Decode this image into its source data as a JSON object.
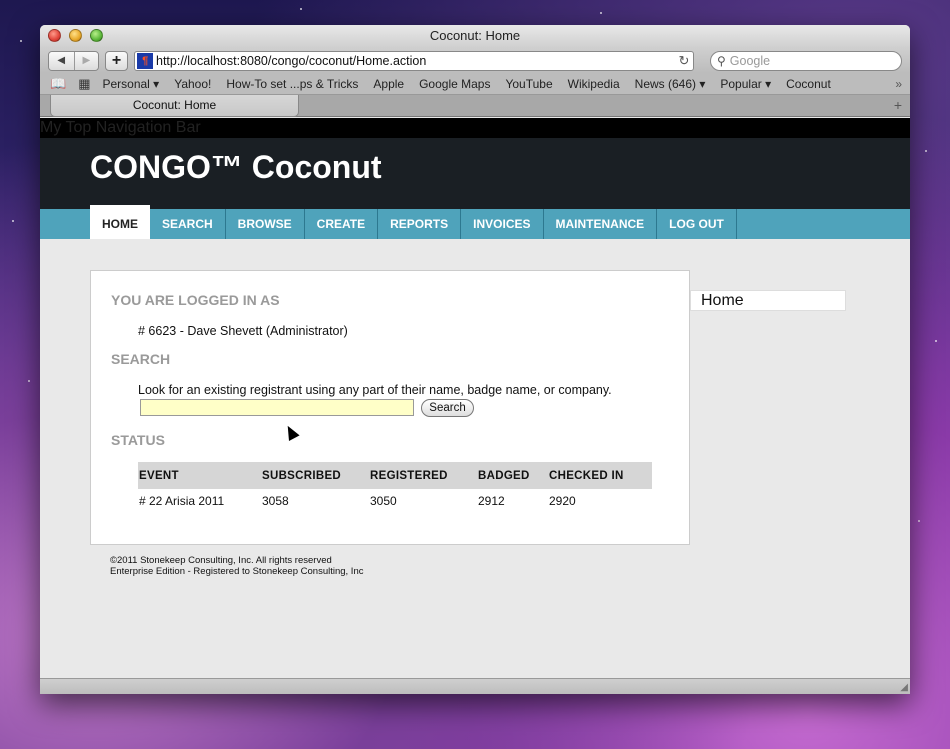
{
  "window": {
    "title": "Coconut: Home"
  },
  "toolbar": {
    "back": "◀",
    "forward": "▶",
    "add": "+",
    "url": "http://localhost:8080/congo/coconut/Home.action",
    "reload": "↻",
    "search_placeholder": "Google"
  },
  "bookmarks": {
    "items": [
      "Personal ▾",
      "Yahoo!",
      "How-To set ...ps & Tricks",
      "Apple",
      "Google Maps",
      "YouTube",
      "Wikipedia",
      "News (646) ▾",
      "Popular ▾",
      "Coconut"
    ],
    "more": "»"
  },
  "tab": {
    "label": "Coconut: Home",
    "add": "+"
  },
  "page": {
    "topnav_label": "My Top Navigation Bar",
    "site_title": "CONGO™ Coconut",
    "menu": [
      "HOME",
      "SEARCH",
      "BROWSE",
      "CREATE",
      "REPORTS",
      "INVOICES",
      "MAINTENANCE",
      "LOG OUT"
    ],
    "logged_in_heading": "YOU ARE LOGGED IN AS",
    "user": "# 6623 - Dave Shevett (Administrator)",
    "search_heading": "SEARCH",
    "search_hint": "Look for an existing registrant using any part of their name, badge name, or company.",
    "search_button": "Search",
    "status_heading": "STATUS",
    "status_columns": [
      "EVENT",
      "SUBSCRIBED",
      "REGISTERED",
      "BADGED",
      "CHECKED IN"
    ],
    "status_rows": [
      [
        "# 22 Arisia 2011",
        "3058",
        "3050",
        "2912",
        "2920"
      ]
    ],
    "sidebar_label": "Home",
    "footer_line1": "©2011 Stonekeep Consulting, Inc. All rights reserved",
    "footer_line2": "Enterprise Edition - Registered to Stonekeep Consulting, Inc"
  },
  "colors": {
    "header_bg": "#1a1f24",
    "menu_bg": "#4fa3bb",
    "search_field_bg": "#ffffc8"
  }
}
